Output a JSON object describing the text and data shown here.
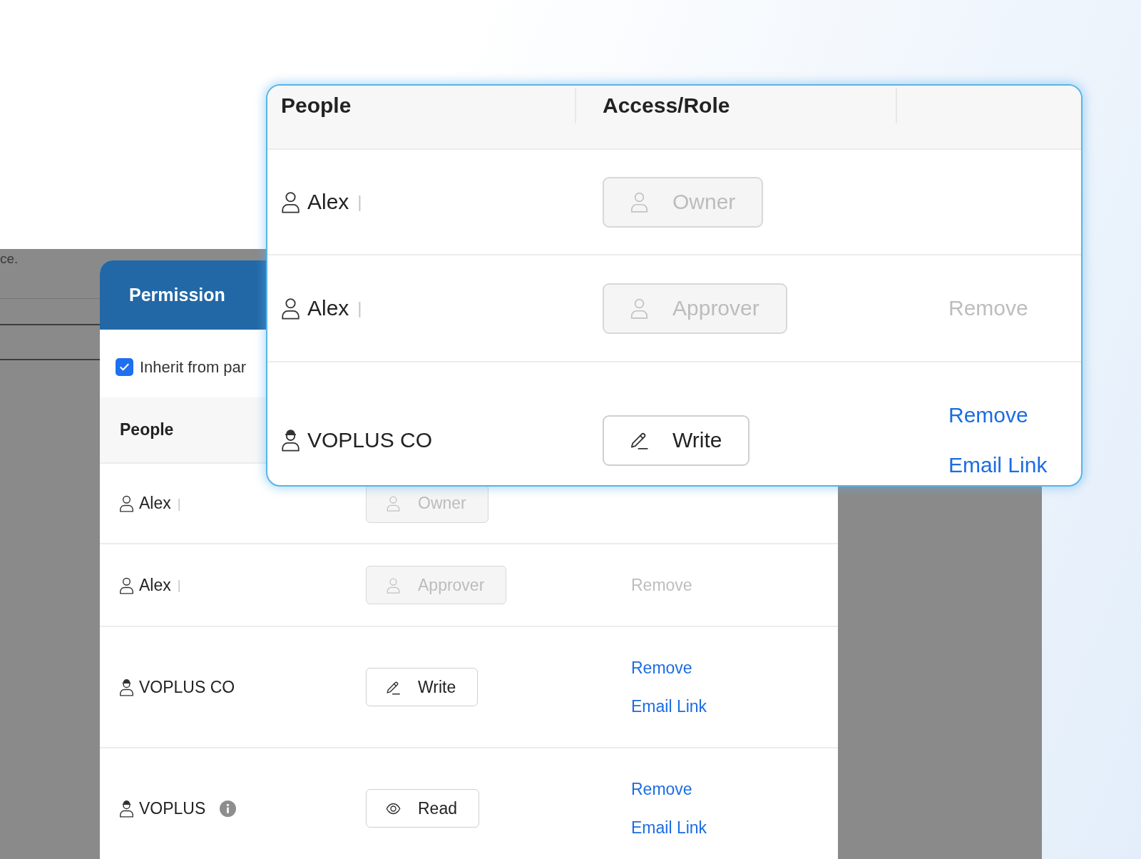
{
  "background_page": {
    "text": "ce."
  },
  "permission_dialog": {
    "title": "Permission",
    "inherit_checkbox": {
      "label": "Inherit from par",
      "checked": true
    },
    "table": {
      "columns": [
        "People"
      ],
      "rows": [
        {
          "kind": "individual",
          "name": "Alex",
          "separator": "|",
          "info": false,
          "role": {
            "kind": "owner",
            "label": "Owner",
            "disabled": true
          }
        },
        {
          "kind": "individual",
          "name": "Alex",
          "separator": "|",
          "info": false,
          "role": {
            "kind": "approver",
            "label": "Approver",
            "disabled": true
          },
          "actions": [
            {
              "label": "Remove",
              "disabled": true
            }
          ]
        },
        {
          "kind": "organization",
          "name": "VOPLUS CO",
          "info": false,
          "role": {
            "kind": "write",
            "label": "Write",
            "disabled": false
          },
          "actions": [
            {
              "label": "Remove",
              "disabled": false
            },
            {
              "label": "Email Link",
              "disabled": false
            }
          ]
        },
        {
          "kind": "organization",
          "name": "VOPLUS",
          "info": true,
          "role": {
            "kind": "read",
            "label": "Read",
            "disabled": false
          },
          "actions": [
            {
              "label": "Remove",
              "disabled": false
            },
            {
              "label": "Email Link",
              "disabled": false
            }
          ]
        }
      ]
    }
  },
  "zoomed_table": {
    "columns": [
      "People",
      "Access/Role"
    ],
    "rows": [
      {
        "kind": "individual",
        "name": "Alex",
        "separator": "|",
        "info": false,
        "role": {
          "kind": "owner",
          "label": "Owner",
          "disabled": true
        }
      },
      {
        "kind": "individual",
        "name": "Alex",
        "separator": "|",
        "info": false,
        "role": {
          "kind": "approver",
          "label": "Approver",
          "disabled": true
        },
        "actions": [
          {
            "label": "Remove",
            "disabled": true
          }
        ]
      },
      {
        "kind": "organization",
        "name": "VOPLUS CO",
        "info": false,
        "role": {
          "kind": "write",
          "label": "Write",
          "disabled": false
        },
        "actions": [
          {
            "label": "Remove",
            "disabled": false
          },
          {
            "label": "Email Link",
            "disabled": false
          }
        ]
      }
    ]
  }
}
